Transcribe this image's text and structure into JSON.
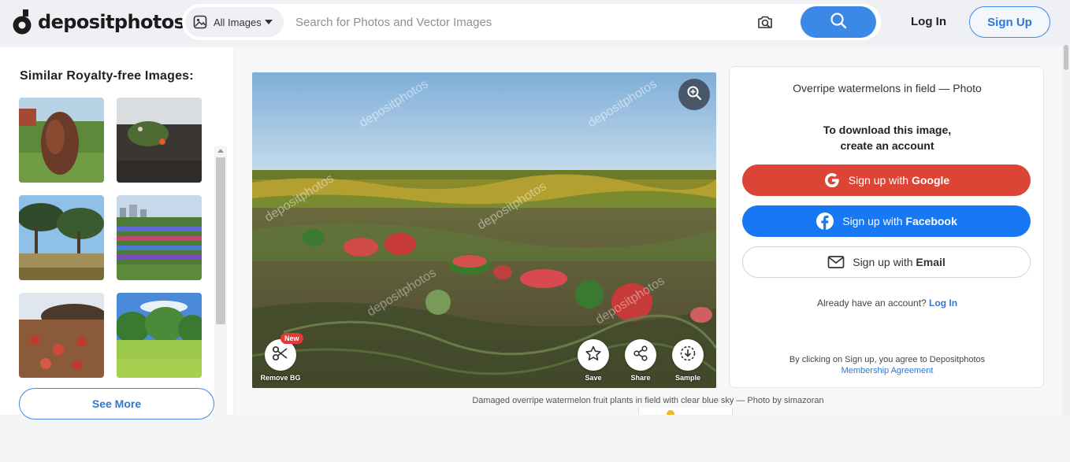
{
  "header": {
    "logo_text": "depositphotos",
    "scope_label": "All Images",
    "search_placeholder": "Search for Photos and Vector Images",
    "search_value": "",
    "login_label": "Log In",
    "signup_label": "Sign Up"
  },
  "sidebar": {
    "title": "Similar Royalty-free Images:",
    "thumbnails": [
      "thumb-1",
      "thumb-2",
      "thumb-3",
      "thumb-4",
      "thumb-5",
      "thumb-6"
    ],
    "see_more_label": "See More"
  },
  "image": {
    "watermark": "depositphotos",
    "tools": {
      "remove_bg": "Remove BG",
      "new_badge": "New",
      "save": "Save",
      "share": "Share",
      "sample": "Sample"
    },
    "caption": "Damaged overripe watermelon fruit plants in field with clear blue sky — Photo by simazoran"
  },
  "panel": {
    "title": "Overripe watermelons in field — Photo",
    "cta_line1": "To download this image,",
    "cta_line2": "create an account",
    "google_prefix": "Sign up with ",
    "google_strong": "Google",
    "facebook_prefix": "Sign up with ",
    "facebook_strong": "Facebook",
    "email_prefix": "Sign up with ",
    "email_strong": "Email",
    "already_text": "Already have an account?",
    "already_link": "Log In",
    "legal_text": "By clicking on Sign up, you agree to Depositphotos",
    "legal_link": "Membership Agreement"
  },
  "colors": {
    "accent": "#3b88e6",
    "google": "#dc4536",
    "facebook": "#1877f2",
    "badge": "#e53935"
  }
}
